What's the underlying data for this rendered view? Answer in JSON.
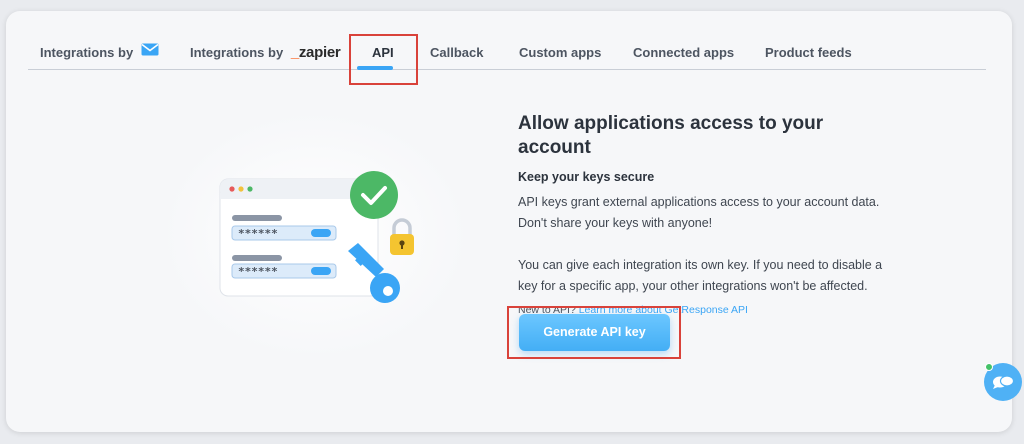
{
  "tabs": [
    {
      "label": "Integrations by",
      "icon": "envelope-icon"
    },
    {
      "label": "Integrations by",
      "brand": "zapier"
    },
    {
      "label": "API",
      "active": true
    },
    {
      "label": "Callback"
    },
    {
      "label": "Custom apps"
    },
    {
      "label": "Connected apps"
    },
    {
      "label": "Product feeds"
    }
  ],
  "illustration": {
    "masked_key_1": "******",
    "masked_key_2": "******"
  },
  "content": {
    "title": "Allow applications access to your account",
    "subtitle": "Keep your keys secure",
    "para1_line1": "API keys grant external applications access to your account data.",
    "para1_line2": "Don't share your keys with anyone!",
    "para2_line1": "You can give each integration its own key. If you need to disable a",
    "para2_line2": "key for a specific app, your other integrations won't be affected.",
    "help_prefix": "New to API?",
    "help_link": "Learn more about GetResponse API"
  },
  "actions": {
    "generate_label": "Generate API key"
  },
  "colors": {
    "accent": "#3aa5f5",
    "highlight_box": "#d9423a",
    "check_green": "#4cb866",
    "lock_yellow": "#f4c430"
  }
}
